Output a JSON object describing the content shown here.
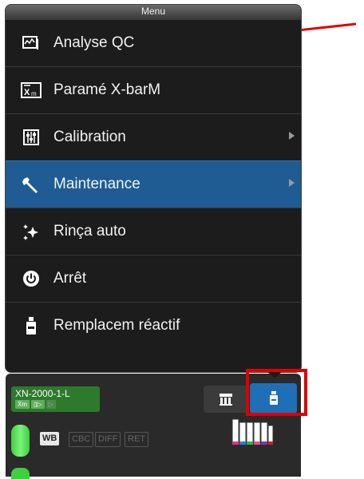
{
  "menu": {
    "title": "Menu",
    "items": [
      {
        "label": "Analyse QC",
        "icon": "qc-analysis-icon",
        "submenu": false,
        "selected": false
      },
      {
        "label": "Paramé X-barM",
        "icon": "xbar-icon",
        "submenu": false,
        "selected": false
      },
      {
        "label": "Calibration",
        "icon": "calibration-icon",
        "submenu": true,
        "selected": false
      },
      {
        "label": "Maintenance",
        "icon": "wrench-icon",
        "submenu": true,
        "selected": true
      },
      {
        "label": "Rinça auto",
        "icon": "sparkle-icon",
        "submenu": false,
        "selected": false
      },
      {
        "label": "Arrêt",
        "icon": "power-icon",
        "submenu": false,
        "selected": false
      },
      {
        "label": "Remplacem réactif",
        "icon": "reagent-bottle-icon",
        "submenu": false,
        "selected": false
      }
    ]
  },
  "device": {
    "name": "XN-2000-1-L",
    "chips": [
      "X̄m",
      "▯▷",
      "▷"
    ],
    "modes": [
      "WB",
      "CBC",
      "DIFF",
      "RET"
    ]
  },
  "colors": {
    "selected_item": "#1e5c93",
    "device_green": "#2d7a2d",
    "active_button": "#1e6fb8",
    "annotation_red": "#e00000"
  }
}
